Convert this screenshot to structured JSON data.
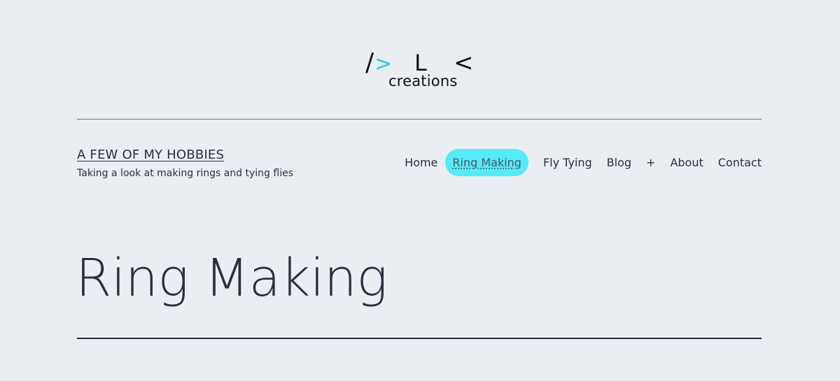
{
  "logo": {
    "slash": "/",
    "gt": ">",
    "letter": "L",
    "lt": "<",
    "text": "creations"
  },
  "site": {
    "title": "A FEW OF MY HOBBIES",
    "tagline": "Taking a look at making rings and tying flies"
  },
  "nav": {
    "items": [
      {
        "label": "Home"
      },
      {
        "label": "Ring Making"
      },
      {
        "label": "Fly Tying"
      },
      {
        "label": "Blog"
      },
      {
        "label": "+"
      },
      {
        "label": "About"
      },
      {
        "label": "Contact"
      }
    ],
    "active_index": 1
  },
  "page": {
    "heading": "Ring Making"
  },
  "colors": {
    "background": "#eaeef3",
    "text": "#28303d",
    "accent": "#55eaf7",
    "logo_accent": "#2cc9f0"
  }
}
